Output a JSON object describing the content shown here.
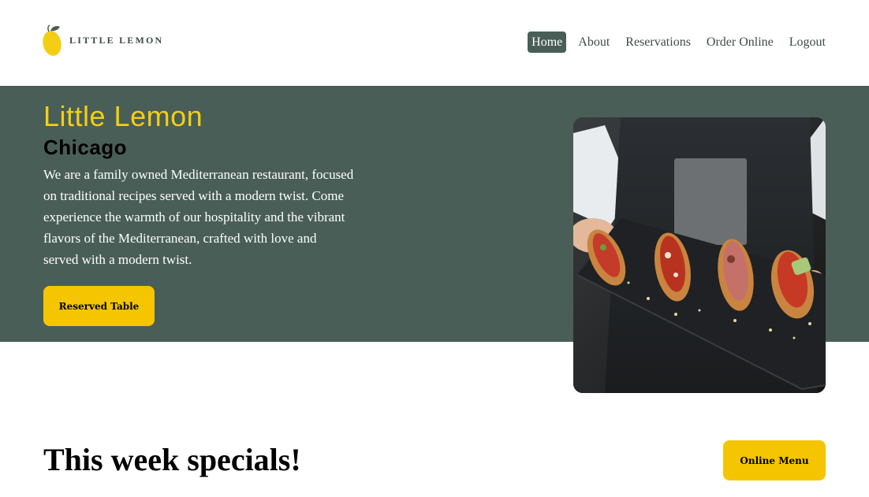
{
  "brand": {
    "logo_text": "LITTLE LEMON"
  },
  "nav": {
    "items": [
      {
        "label": "Home",
        "active": true
      },
      {
        "label": "About",
        "active": false
      },
      {
        "label": "Reservations",
        "active": false
      },
      {
        "label": "Order Online",
        "active": false
      },
      {
        "label": "Logout",
        "active": false
      }
    ]
  },
  "hero": {
    "title": "Little Lemon",
    "subtitle": "Chicago",
    "description": "We are a family owned Mediterranean restaurant, focused on traditional recipes served with a modern twist. Come experience the warmth of our hospitality and the vibrant flavors of the Mediterranean, crafted with love and served with a modern twist.",
    "cta_label": "Reserved Table"
  },
  "specials": {
    "title": "This week specials!",
    "menu_button_label": "Online Menu"
  },
  "colors": {
    "primary_green": "#495e57",
    "primary_yellow": "#f4ce14",
    "button_yellow": "#f4c500"
  }
}
